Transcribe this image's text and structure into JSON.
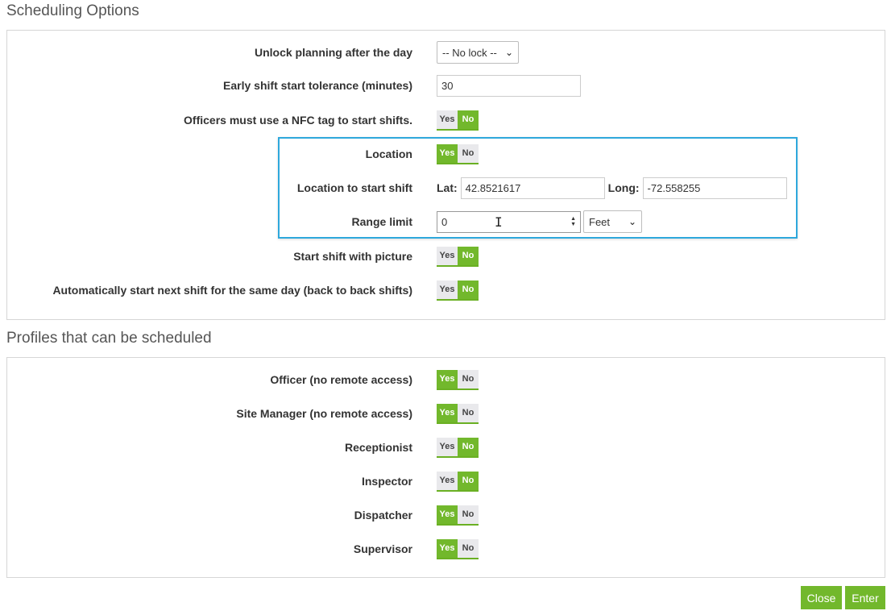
{
  "scheduling": {
    "title": "Scheduling Options",
    "unlock": {
      "label": "Unlock planning after the day",
      "value": "-- No lock --"
    },
    "tolerance": {
      "label": "Early shift start tolerance (minutes)",
      "value": "30"
    },
    "nfc": {
      "label": "Officers must use a NFC tag to start shifts.",
      "state": "No"
    },
    "location": {
      "label": "Location",
      "state": "Yes"
    },
    "location_start": {
      "label": "Location to start shift",
      "lat_label": "Lat:",
      "lat_value": "42.8521617",
      "long_label": "Long:",
      "long_value": "-72.558255"
    },
    "range_limit": {
      "label": "Range limit",
      "value": "0",
      "unit": "Feet"
    },
    "picture": {
      "label": "Start shift with picture",
      "state": "No"
    },
    "back_to_back": {
      "label": "Automatically start next shift for the same day (back to back shifts)",
      "state": "No"
    }
  },
  "profiles": {
    "title": "Profiles that can be scheduled",
    "items": [
      {
        "label": "Officer (no remote access)",
        "state": "Yes"
      },
      {
        "label": "Site Manager (no remote access)",
        "state": "Yes"
      },
      {
        "label": "Receptionist",
        "state": "No"
      },
      {
        "label": "Inspector",
        "state": "No"
      },
      {
        "label": "Dispatcher",
        "state": "Yes"
      },
      {
        "label": "Supervisor",
        "state": "Yes"
      }
    ]
  },
  "toggle": {
    "yes_label": "Yes",
    "no_label": "No"
  },
  "buttons": {
    "close_label": "Close",
    "enter_label": "Enter"
  },
  "colors": {
    "accent_green": "#72b82c",
    "highlight_blue": "#2ea8dc",
    "toggle_off": "#e9e9ec"
  },
  "icons": {
    "select": "chevron-down-icon",
    "spinner": "spinner-arrows-icon",
    "cursor": "text-cursor-icon"
  }
}
